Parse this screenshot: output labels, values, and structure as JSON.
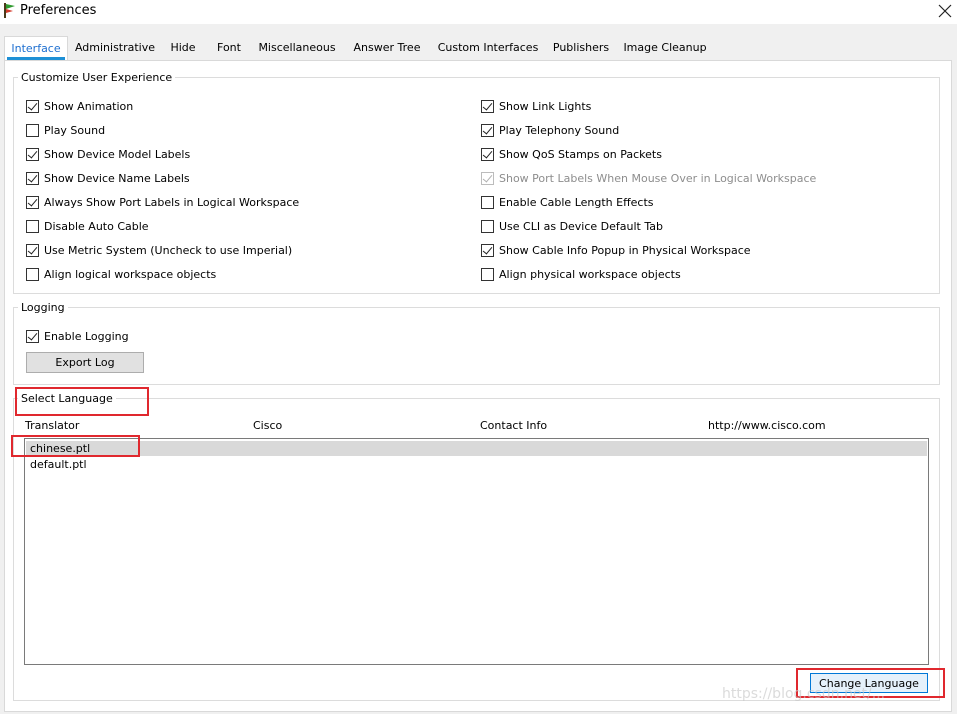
{
  "window": {
    "title": "Preferences"
  },
  "tabs": [
    {
      "label": "Interface",
      "active": true
    },
    {
      "label": "Administrative"
    },
    {
      "label": "Hide"
    },
    {
      "label": "Font"
    },
    {
      "label": "Miscellaneous"
    },
    {
      "label": "Answer Tree"
    },
    {
      "label": "Custom Interfaces"
    },
    {
      "label": "Publishers"
    },
    {
      "label": "Image Cleanup"
    }
  ],
  "customize": {
    "legend": "Customize User Experience",
    "left": [
      {
        "label": "Show Animation",
        "checked": true
      },
      {
        "label": "Play Sound",
        "checked": false
      },
      {
        "label": "Show Device Model Labels",
        "checked": true
      },
      {
        "label": "Show Device Name Labels",
        "checked": true
      },
      {
        "label": "Always Show Port Labels in Logical Workspace",
        "checked": true
      },
      {
        "label": "Disable Auto Cable",
        "checked": false
      },
      {
        "label": "Use Metric System (Uncheck to use Imperial)",
        "checked": true
      },
      {
        "label": "Align logical workspace objects",
        "checked": false
      }
    ],
    "right": [
      {
        "label": "Show Link Lights",
        "checked": true
      },
      {
        "label": "Play Telephony Sound",
        "checked": true
      },
      {
        "label": "Show QoS Stamps on Packets",
        "checked": true
      },
      {
        "label": "Show Port Labels When Mouse Over in Logical Workspace",
        "checked": true,
        "disabled": true
      },
      {
        "label": "Enable Cable Length Effects",
        "checked": false
      },
      {
        "label": "Use CLI as Device Default Tab",
        "checked": false
      },
      {
        "label": "Show Cable Info Popup in Physical Workspace",
        "checked": true
      },
      {
        "label": "Align physical workspace objects",
        "checked": false
      }
    ]
  },
  "logging": {
    "legend": "Logging",
    "enable_label": "Enable Logging",
    "enable_checked": true,
    "export_label": "Export Log"
  },
  "language": {
    "legend": "Select Language",
    "columns": [
      "Translator",
      "Cisco",
      "Contact Info",
      "http://www.cisco.com"
    ],
    "items": [
      {
        "label": "chinese.ptl",
        "selected": true
      },
      {
        "label": "default.ptl",
        "selected": false
      }
    ],
    "change_label": "Change Language"
  },
  "annotation_color": "#e0282e",
  "accent_color": "#1e90d6",
  "watermark": "https://blog.csdn.net/..."
}
